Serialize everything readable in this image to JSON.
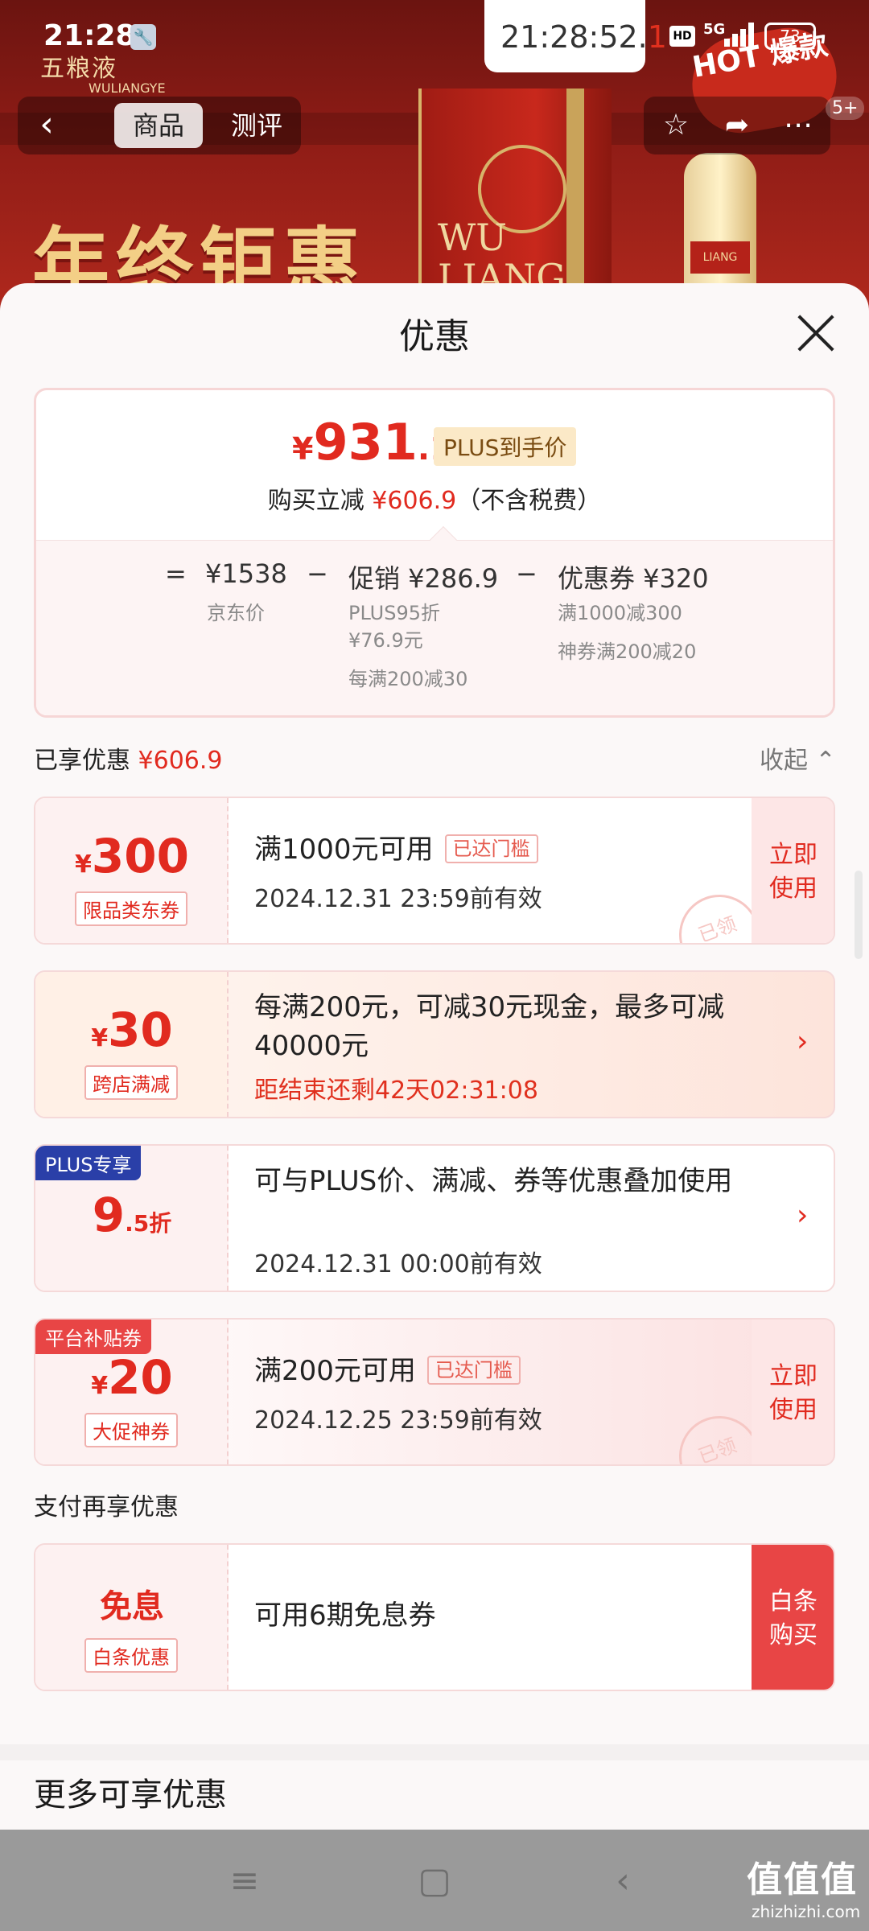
{
  "status_bar": {
    "time": "21:28",
    "clock_chip_main": "21:28:52.",
    "clock_chip_last": "1",
    "hd_label": "HD",
    "network": "5G",
    "battery": "73"
  },
  "background": {
    "brand": "五粮液",
    "brand_sub": "WULIANGYE",
    "product_mark": "WU\nLIANG",
    "hot_badge": "HOT 爆款",
    "bottle_label": "LIANG",
    "promo_text": "年终钜惠"
  },
  "top_nav": {
    "tabs": [
      "商品",
      "测评"
    ],
    "badge": "5+"
  },
  "sheet": {
    "title": "优惠",
    "price": {
      "yen": "¥",
      "int": "931",
      "dec": ".1",
      "plus_tag": "PLUS到手价",
      "save_prefix": "购买立减 ",
      "save_amount": "¥606.9",
      "save_suffix": "（不含税费）"
    },
    "formula": {
      "equals": "=",
      "jd_price": "¥1538",
      "jd_price_label": "京东价",
      "minus1": "−",
      "promo": "促销 ¥286.9",
      "promo_items": [
        "PLUS95折",
        "¥76.9元",
        "每满200减30"
      ],
      "minus2": "−",
      "coupon": "优惠券 ¥320",
      "coupon_items": [
        "满1000减300",
        "神券满200减20"
      ]
    },
    "enjoyed_prefix": "已享优惠 ",
    "enjoyed_amount": "¥606.9",
    "collapse": "收起 ⌃",
    "coupons": [
      {
        "yen": "¥",
        "amount": "300",
        "tag": "限品类东券",
        "main": "满1000元可用",
        "reached": "已达门槛",
        "sub": "2024.12.31 23:59前有效",
        "button": "立即\n使用",
        "stamp": "已领"
      },
      {
        "yen": "¥",
        "amount": "30",
        "tag": "跨店满减",
        "main": "每满200元，可减30元现金，最多可减40000元",
        "sub": "距结束还剩42天02:31:08"
      },
      {
        "corner": "PLUS专享",
        "amount": "9",
        "amount_suffix": ".5折",
        "main": "可与PLUS价、满减、券等优惠叠加使用",
        "sub": "2024.12.31 00:00前有效"
      },
      {
        "corner": "平台补贴券",
        "yen": "¥",
        "amount": "20",
        "tag": "大促神券",
        "main": "满200元可用",
        "reached": "已达门槛",
        "sub": "2024.12.25 23:59前有效",
        "button": "立即\n使用",
        "stamp": "已领"
      }
    ],
    "pay_section_label": "支付再享优惠",
    "pay_coupon": {
      "title": "免息",
      "tag": "白条优惠",
      "main": "可用6期免息券",
      "button": "白条\n购买"
    },
    "more_title": "更多可享优惠"
  },
  "watermark": {
    "text": "值值值",
    "sub": "zhizhizhi.com"
  },
  "colors": {
    "accent": "#e12a1f",
    "plus_blue": "#2a3fa8",
    "platform_red": "#e84545"
  }
}
